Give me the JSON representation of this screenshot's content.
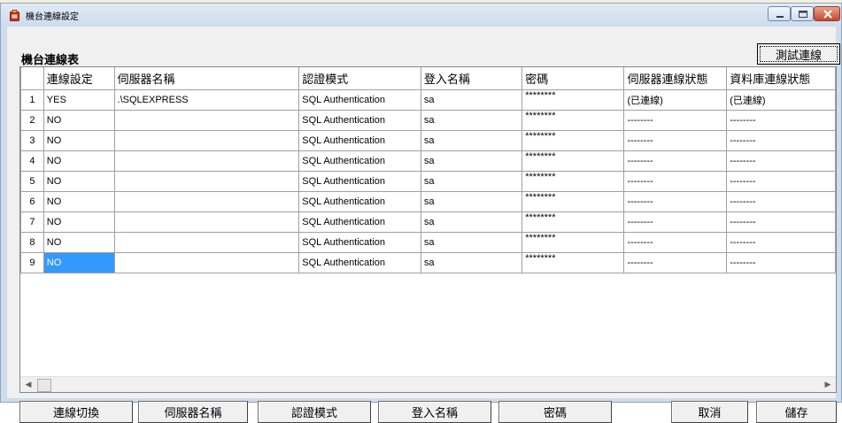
{
  "window": {
    "title": "機台連線設定",
    "icon": "app-icon",
    "controls": {
      "minimize": "minimize-icon",
      "maximize": "maximize-icon",
      "close": "close-icon"
    }
  },
  "section_title": "機台連線表",
  "test_button_label": "測試連線",
  "grid": {
    "columns": [
      "連線設定",
      "伺服器名稱",
      "認證模式",
      "登入名稱",
      "密碼",
      "伺服器連線狀態",
      "資料庫連線狀態"
    ],
    "rows": [
      {
        "num": "1",
        "cells": [
          "YES",
          ".\\SQLEXPRESS",
          "SQL Authentication",
          "sa",
          "********",
          "(已連線)",
          "(已連線)"
        ]
      },
      {
        "num": "2",
        "cells": [
          "NO",
          "",
          "SQL Authentication",
          "sa",
          "********",
          "--------",
          "--------"
        ]
      },
      {
        "num": "3",
        "cells": [
          "NO",
          "",
          "SQL Authentication",
          "sa",
          "********",
          "--------",
          "--------"
        ]
      },
      {
        "num": "4",
        "cells": [
          "NO",
          "",
          "SQL Authentication",
          "sa",
          "********",
          "--------",
          "--------"
        ]
      },
      {
        "num": "5",
        "cells": [
          "NO",
          "",
          "SQL Authentication",
          "sa",
          "********",
          "--------",
          "--------"
        ]
      },
      {
        "num": "6",
        "cells": [
          "NO",
          "",
          "SQL Authentication",
          "sa",
          "********",
          "--------",
          "--------"
        ]
      },
      {
        "num": "7",
        "cells": [
          "NO",
          "",
          "SQL Authentication",
          "sa",
          "********",
          "--------",
          "--------"
        ]
      },
      {
        "num": "8",
        "cells": [
          "NO",
          "",
          "SQL Authentication",
          "sa",
          "********",
          "--------",
          "--------"
        ]
      },
      {
        "num": "9",
        "cells": [
          "NO",
          "",
          "SQL Authentication",
          "sa",
          "********",
          "--------",
          "--------"
        ]
      }
    ],
    "selected_row": 9,
    "selected_color": "#3399ff"
  },
  "buttons": {
    "toggle": "連線切換",
    "server_name": "伺服器名稱",
    "auth_mode": "認證模式",
    "login_name": "登入名稱",
    "password": "密碼",
    "cancel": "取消",
    "save": "儲存"
  }
}
